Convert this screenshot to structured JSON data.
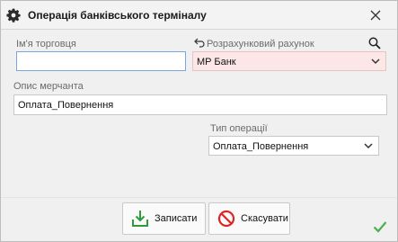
{
  "window": {
    "title": "Операція банківського терміналу"
  },
  "form": {
    "merchant_name": {
      "label": "Ім'я торговця",
      "value": ""
    },
    "account": {
      "label": "Розрахунковий рахунок",
      "value": "MP Банк"
    },
    "merchant_description": {
      "label": "Опис мерчанта",
      "value": "Оплата_Повернення"
    },
    "operation_type": {
      "label": "Тип операції",
      "value": "Оплата_Повернення"
    }
  },
  "buttons": {
    "save_label": "Записати",
    "cancel_label": "Скасувати"
  },
  "colors": {
    "save_icon": "#2e9b3a",
    "cancel_icon": "#e02424",
    "required_field_bg": "#fde6e6",
    "ok_check": "#4caf50"
  },
  "icons": [
    "gear-icon",
    "close-icon",
    "back-arrow-icon",
    "search-icon",
    "chevron-down-icon",
    "save-icon",
    "cancel-icon",
    "checkmark-icon"
  ]
}
